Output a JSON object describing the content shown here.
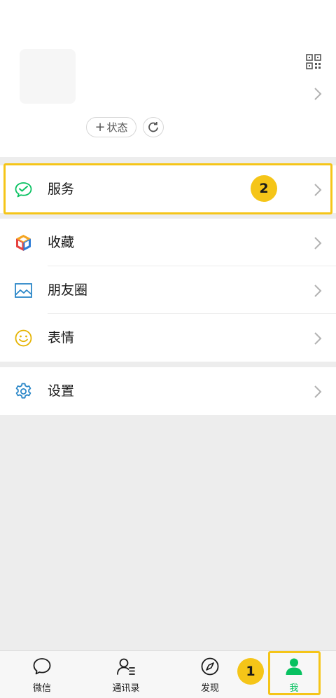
{
  "profile": {
    "status_label": "状态",
    "qr_icon": "qr-code-icon",
    "refresh_icon": "refresh-icon"
  },
  "menu": {
    "services": {
      "label": "服务",
      "icon": "wechat-pay-icon",
      "step_badge": "2"
    },
    "favorites": {
      "label": "收藏",
      "icon": "cube-icon"
    },
    "moments": {
      "label": "朋友圈",
      "icon": "image-icon"
    },
    "stickers": {
      "label": "表情",
      "icon": "smiley-icon"
    },
    "settings": {
      "label": "设置",
      "icon": "gear-icon"
    }
  },
  "tabbar": {
    "chats": "微信",
    "contacts": "通讯录",
    "discover": "发现",
    "me": "我",
    "step_badge": "1"
  },
  "colors": {
    "accent_green": "#07c160",
    "highlight_yellow": "#f5c518",
    "background": "#ededed"
  }
}
